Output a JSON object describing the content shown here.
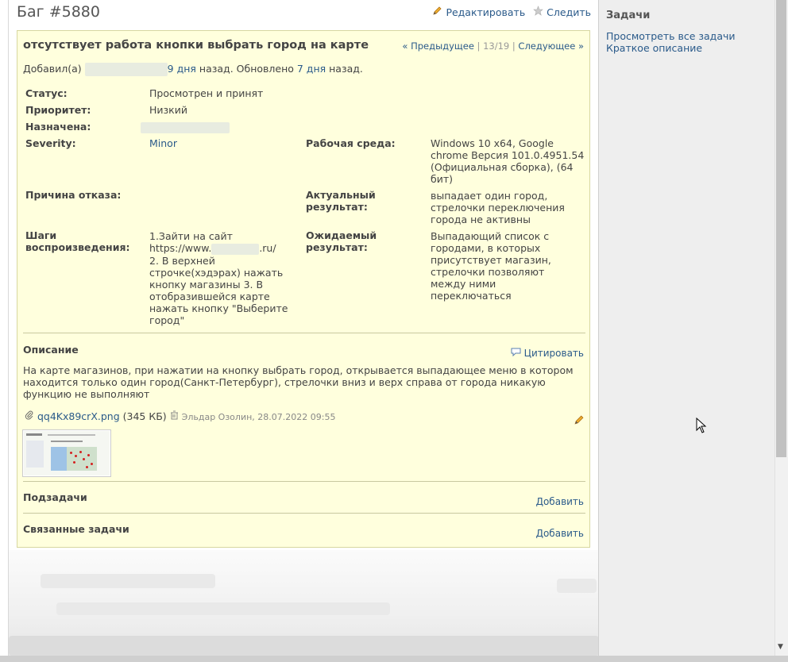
{
  "header": {
    "title": "Баг #5880",
    "edit_label": "Редактировать",
    "watch_label": "Следить"
  },
  "issue": {
    "subject": "отсутствует работа кнопки выбрать город на карте",
    "nav": {
      "prev": "« Предыдущее",
      "sep1": "|",
      "position": "13/19",
      "sep2": "|",
      "next": "Следующее »"
    },
    "author_prefix": "Добавил(а)",
    "added_ago": "9 дня",
    "mid_text": "назад. Обновлено",
    "updated_ago": "7 дня",
    "suffix": "назад.",
    "attributes": {
      "status_label": "Статус:",
      "status_value": "Просмотрен и принят",
      "priority_label": "Приоритет:",
      "priority_value": "Низкий",
      "assigned_label": "Назначена:",
      "severity_label": "Severity:",
      "severity_value": "Minor",
      "env_label": "Рабочая среда:",
      "env_value": "Windows 10 x64, Google chrome Версия 101.0.4951.54 (Официальная сборка), (64 бит)",
      "reject_label": "Причина отказа:",
      "actual_label": "Актуальный результат:",
      "actual_value": "выпадает один город, стрелочки переключения города не активны",
      "steps_label": "Шаги воспроизведения:",
      "steps_line1": "1.Зайти на сайт",
      "steps_line2a": "https://www.",
      "steps_line2b": ".ru/",
      "steps_rest": "2. В верхней строчке(хэдэрах) нажать кнопку магазины 3. В отобразившейся карте нажать кнопку \"Выберите город\"",
      "expected_label": "Ожидаемый результат:",
      "expected_value": "Выпадающий список с городами, в которых присутствует магазин, стрелочки позволяют между ними переключаться"
    },
    "description": {
      "title": "Описание",
      "quote_label": "Цитировать",
      "text": "На карте магазинов, при нажатии на кнопку выбрать город, открывается выпадающее меню в котором находится только один город(Санкт-Петербург), стрелочки вниз и верх справа от города никакую функцию не выполняют"
    },
    "attachment": {
      "filename": "qq4Kx89crX.png",
      "size": "(345 КБ)",
      "meta": "Эльдар Озолин, 28.07.2022 09:55"
    },
    "subtasks": {
      "title": "Подзадачи",
      "add_label": "Добавить"
    },
    "relations": {
      "title": "Связанные задачи",
      "add_label": "Добавить"
    }
  },
  "sidebar": {
    "title": "Задачи",
    "view_all": "Просмотреть все задачи",
    "summary": "Краткое описание"
  },
  "icons": {
    "edit": "pencil-icon",
    "watch": "star-icon",
    "quote": "speech-bubble-icon",
    "attach": "paperclip-icon",
    "delete": "trash-icon"
  }
}
